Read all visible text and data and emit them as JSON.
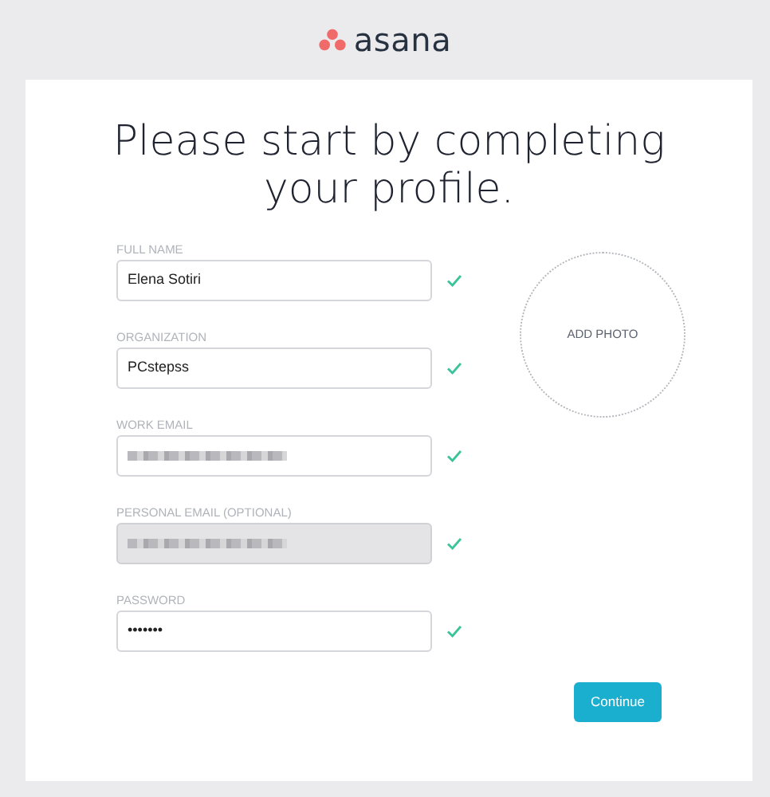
{
  "logo": {
    "text": "asana"
  },
  "title": "Please start by completing your profile.",
  "fields": [
    {
      "label": "FULL NAME",
      "value": "Elena Sotiri",
      "valid": true,
      "disabled": false,
      "redacted": false
    },
    {
      "label": "ORGANIZATION",
      "value": "PCstepss",
      "valid": true,
      "disabled": false,
      "redacted": false
    },
    {
      "label": "WORK EMAIL",
      "valid": true,
      "disabled": false,
      "redacted": true
    },
    {
      "label": "PERSONAL EMAIL (OPTIONAL)",
      "valid": true,
      "disabled": true,
      "redacted": true
    },
    {
      "label": "PASSWORD",
      "value": "•••••••",
      "valid": true,
      "disabled": false,
      "redacted": false
    }
  ],
  "photo": {
    "label": "ADD PHOTO"
  },
  "button": {
    "label": "Continue"
  }
}
